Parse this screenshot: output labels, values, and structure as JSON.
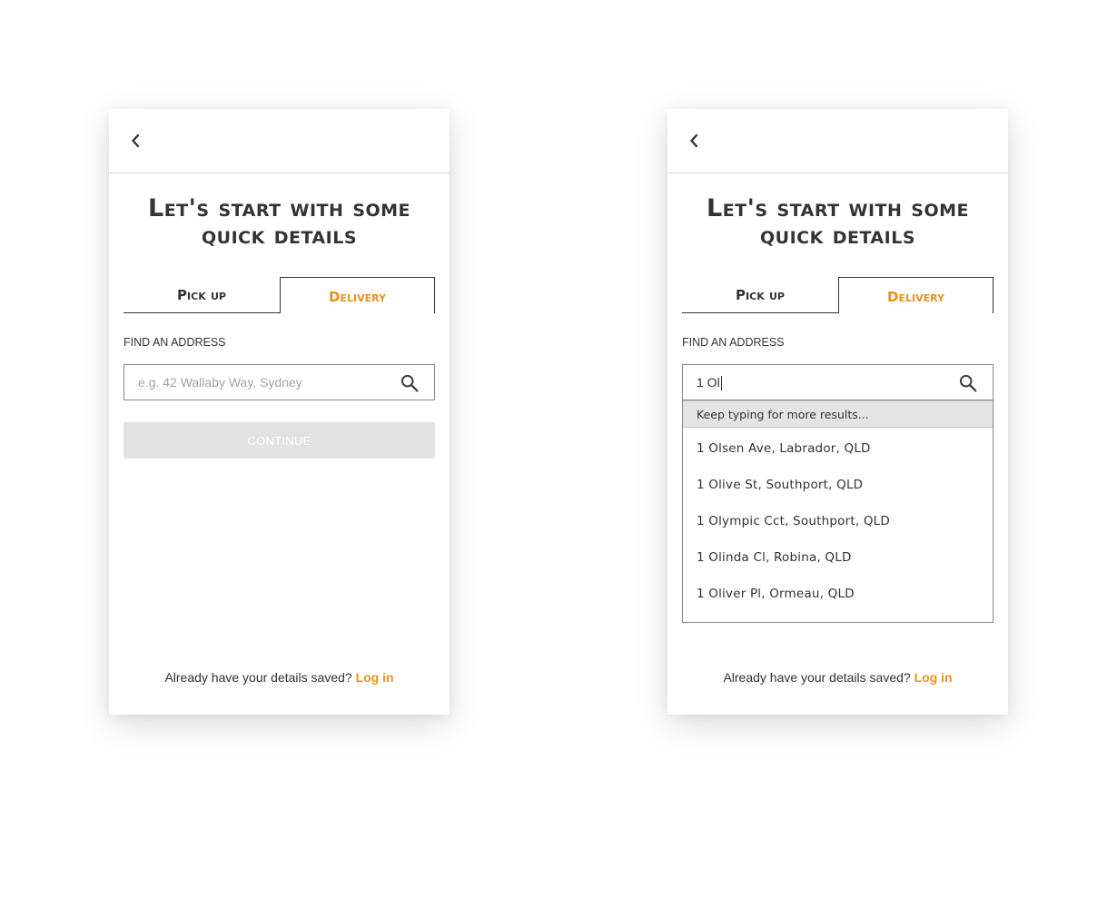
{
  "colors": {
    "accent": "#e8911e",
    "text": "#333333",
    "disabled_button": "#e2e2e2"
  },
  "icons": {
    "back": "chevron-left-icon",
    "search": "search-icon"
  },
  "screens": [
    {
      "heading_line1": "Let's start with some",
      "heading_line2": "quick details",
      "tabs": {
        "pickup": "Pick up",
        "delivery": "Delivery",
        "active": "delivery"
      },
      "field_label": "FIND AN ADDRESS",
      "search": {
        "value": "",
        "placeholder": "e.g. 42 Wallaby Way, Sydney"
      },
      "continue_label": "CONTINUE",
      "footer_text": "Already have your details saved?",
      "login_label": "Log in"
    },
    {
      "heading_line1": "Let's start with some",
      "heading_line2": "quick details",
      "tabs": {
        "pickup": "Pick up",
        "delivery": "Delivery",
        "active": "delivery"
      },
      "field_label": "FIND AN ADDRESS",
      "search": {
        "value": "1 Ol",
        "placeholder": ""
      },
      "suggestions_hint": "Keep typing for more results...",
      "suggestions": [
        "1 Olsen Ave, Labrador, QLD",
        "1 Olive St, Southport, QLD",
        "1 Olympic Cct, Southport, QLD",
        "1 Olinda Cl, Robina, QLD",
        "1 Oliver Pl, Ormeau, QLD"
      ],
      "footer_text": "Already have your details saved?",
      "login_label": "Log in"
    }
  ]
}
